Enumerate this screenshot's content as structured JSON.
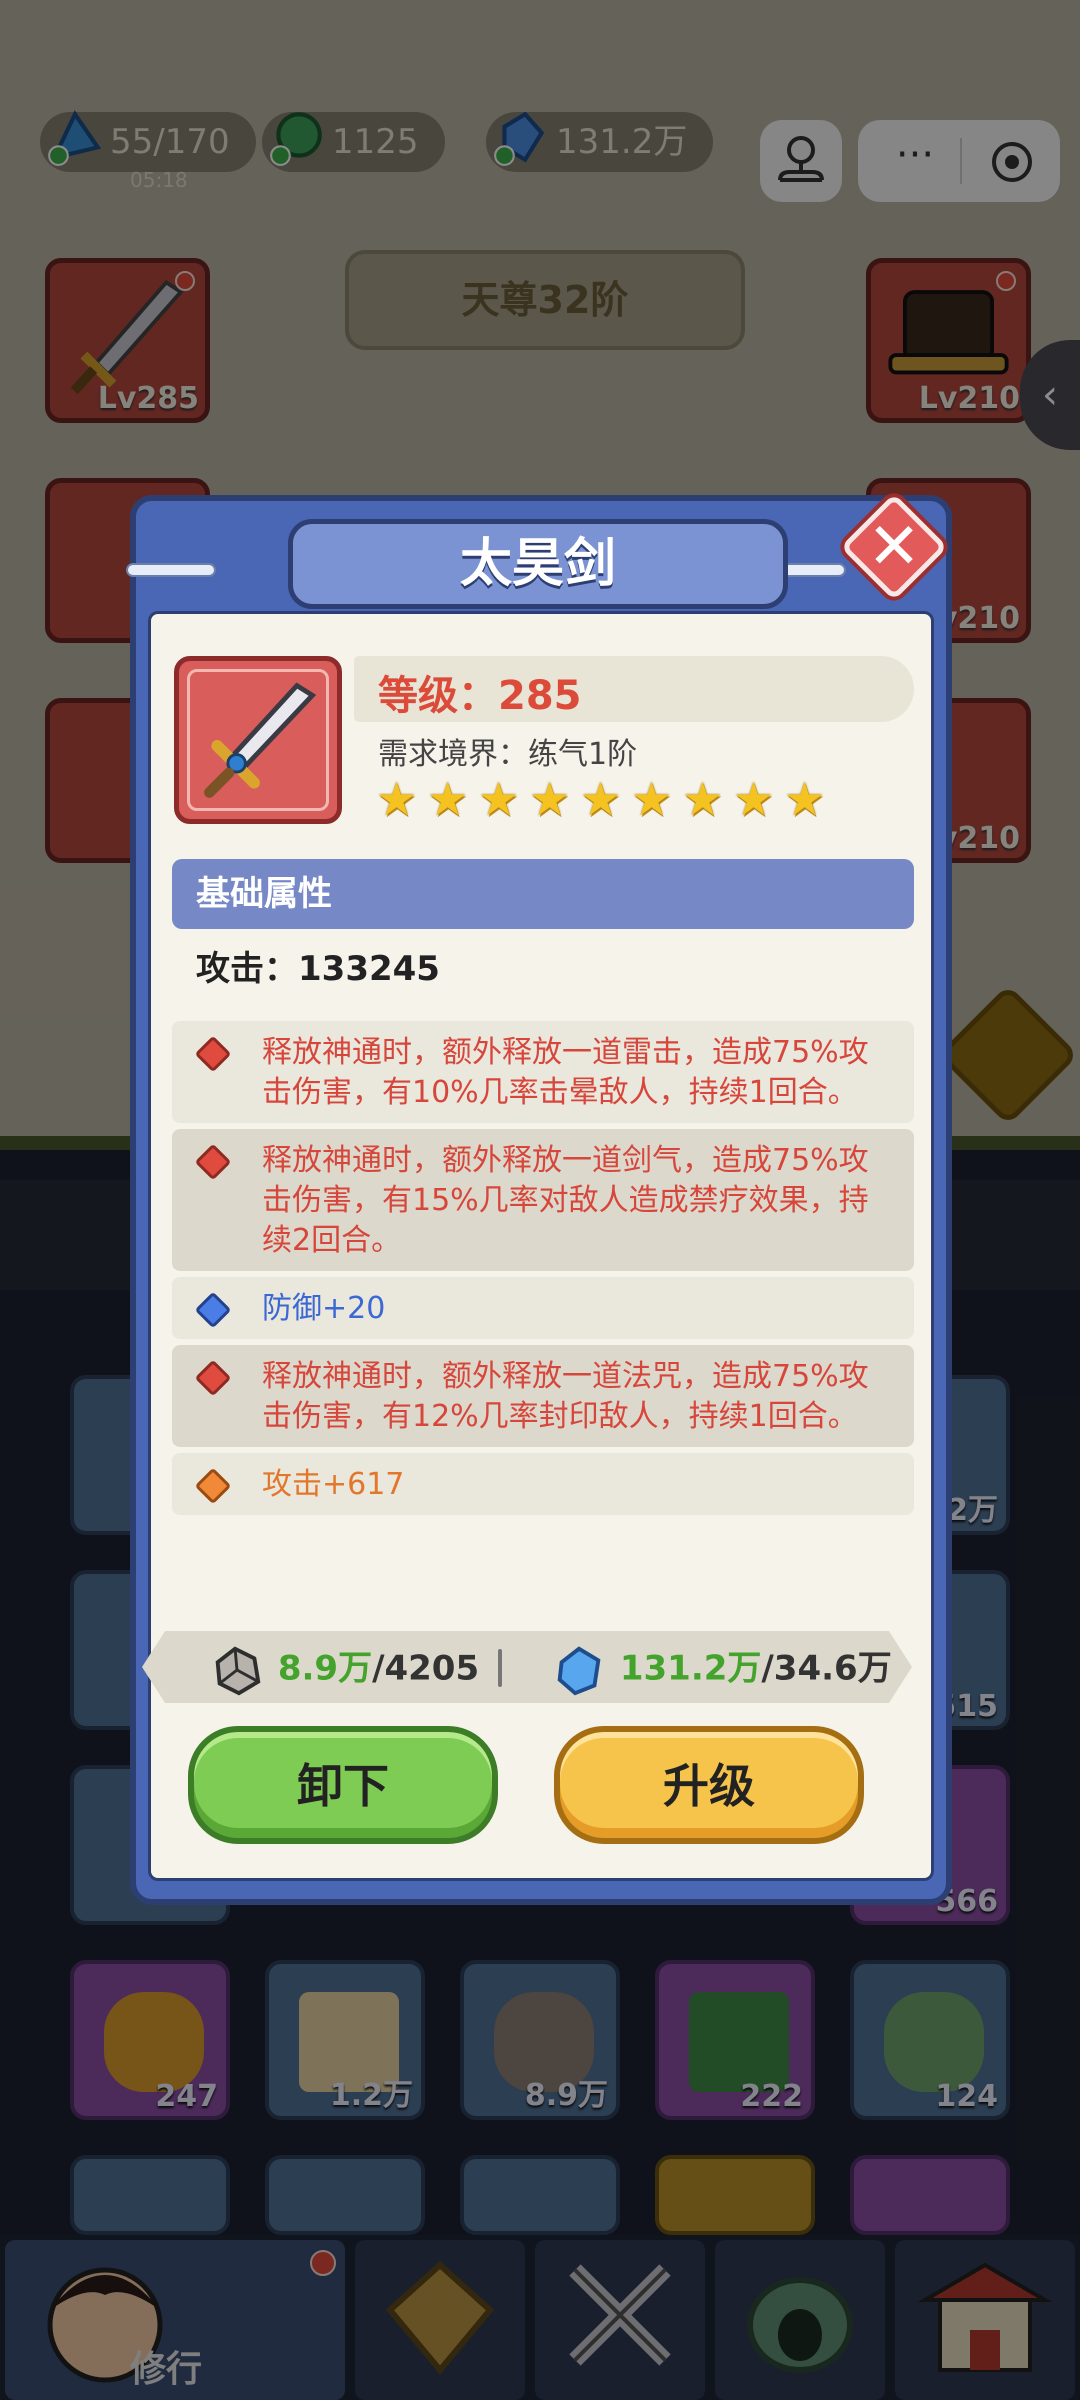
{
  "hud": {
    "stamina": "55/170",
    "stamina_timer": "05:18",
    "coins": "1125",
    "crystals": "131.2万"
  },
  "background": {
    "rank_banner": "天尊32阶",
    "slots": [
      {
        "level": "Lv285"
      },
      {
        "level": "Lv210"
      },
      {
        "level": "Lv210"
      },
      {
        "level": "Lv210"
      }
    ],
    "items": [
      {
        "count": "2万"
      },
      {
        "count": "515"
      },
      {
        "count": "566"
      },
      {
        "count": "247"
      },
      {
        "count": "1.2万"
      },
      {
        "count": "8.9万"
      },
      {
        "count": "222"
      },
      {
        "count": "124"
      }
    ],
    "nav_active_label": "修行"
  },
  "modal": {
    "title": "太昊剑",
    "level_label": "等级：285",
    "requirement": "需求境界：练气1阶",
    "stars": 9,
    "section_title": "基础属性",
    "base_attack": "攻击：133245",
    "attributes": [
      {
        "type": "red",
        "text": "释放神通时，额外释放一道雷击，造成75%攻击伤害，有10%几率击晕敌人，持续1回合。"
      },
      {
        "type": "red",
        "text": "释放神通时，额外释放一道剑气，造成75%攻击伤害，有15%几率对敌人造成禁疗效果，持续2回合。"
      },
      {
        "type": "blue",
        "text": "防御+20"
      },
      {
        "type": "red",
        "text": "释放神通时，额外释放一道法咒，造成75%攻击伤害，有12%几率封印敌人，持续1回合。"
      },
      {
        "type": "orange",
        "text": "攻击+617"
      }
    ],
    "cost": {
      "stone_have": "8.9万",
      "stone_need": "/4205",
      "crystal_have": "131.2万",
      "crystal_need": "/34.6万"
    },
    "unequip_label": "卸下",
    "upgrade_label": "升级"
  }
}
